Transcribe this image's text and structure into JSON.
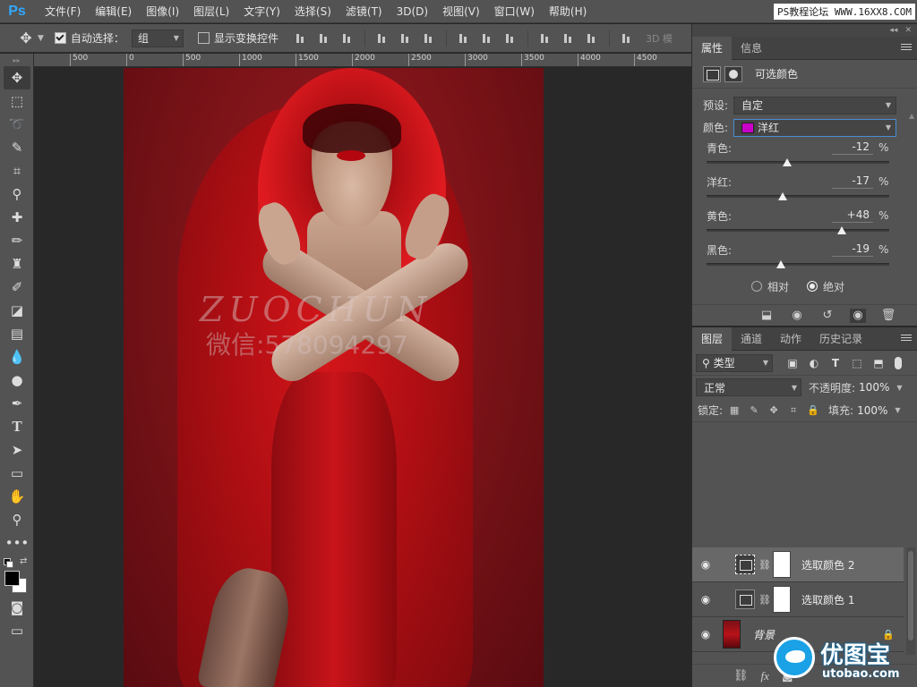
{
  "app": {
    "logo": "Ps"
  },
  "menu": [
    "文件(F)",
    "编辑(E)",
    "图像(I)",
    "图层(L)",
    "文字(Y)",
    "选择(S)",
    "滤镜(T)",
    "3D(D)",
    "视图(V)",
    "窗口(W)",
    "帮助(H)"
  ],
  "menu_watermark": "PS教程论坛 WWW.16XX8.COM",
  "options": {
    "auto_select_label": "自动选择：",
    "auto_select_value": "组",
    "show_transform_label": "显示变换控件",
    "mode_3d": "3D 模"
  },
  "ruler": [
    "500",
    "0",
    "500",
    "1000",
    "1500",
    "2000",
    "2500",
    "3000",
    "3500",
    "4000",
    "4500"
  ],
  "artwork": {
    "watermark_title": "ZUOCHUN",
    "watermark_sub": "微信:578094297"
  },
  "properties": {
    "tabs": [
      "属性",
      "信息"
    ],
    "adjustment_title": "可选颜色",
    "preset_label": "预设:",
    "preset_value": "自定",
    "colors_label": "颜色:",
    "colors_value": "洋红",
    "colors_swatch": "#c800c8",
    "sliders": [
      {
        "name": "青色:",
        "value": "-12",
        "level": -12
      },
      {
        "name": "洋红:",
        "value": "-17",
        "level": -17
      },
      {
        "name": "黄色:",
        "value": "+48",
        "level": 48
      },
      {
        "name": "黑色:",
        "value": "-19",
        "level": -19
      }
    ],
    "percent": "%",
    "mode_relative": "相对",
    "mode_absolute": "绝对"
  },
  "layers": {
    "tabs": [
      "图层",
      "通道",
      "动作",
      "历史记录"
    ],
    "kind_value": "类型",
    "blend_value": "正常",
    "opacity_label": "不透明度:",
    "opacity_value": "100%",
    "lock_label": "锁定:",
    "fill_label": "填充:",
    "fill_value": "100%",
    "items": [
      {
        "name": "选取颜色 2",
        "selected": true
      },
      {
        "name": "选取颜色 1",
        "selected": false
      },
      {
        "name": "背景",
        "selected": false
      }
    ]
  },
  "site_watermark": {
    "name": "优图宝",
    "url": "utobao.com"
  }
}
